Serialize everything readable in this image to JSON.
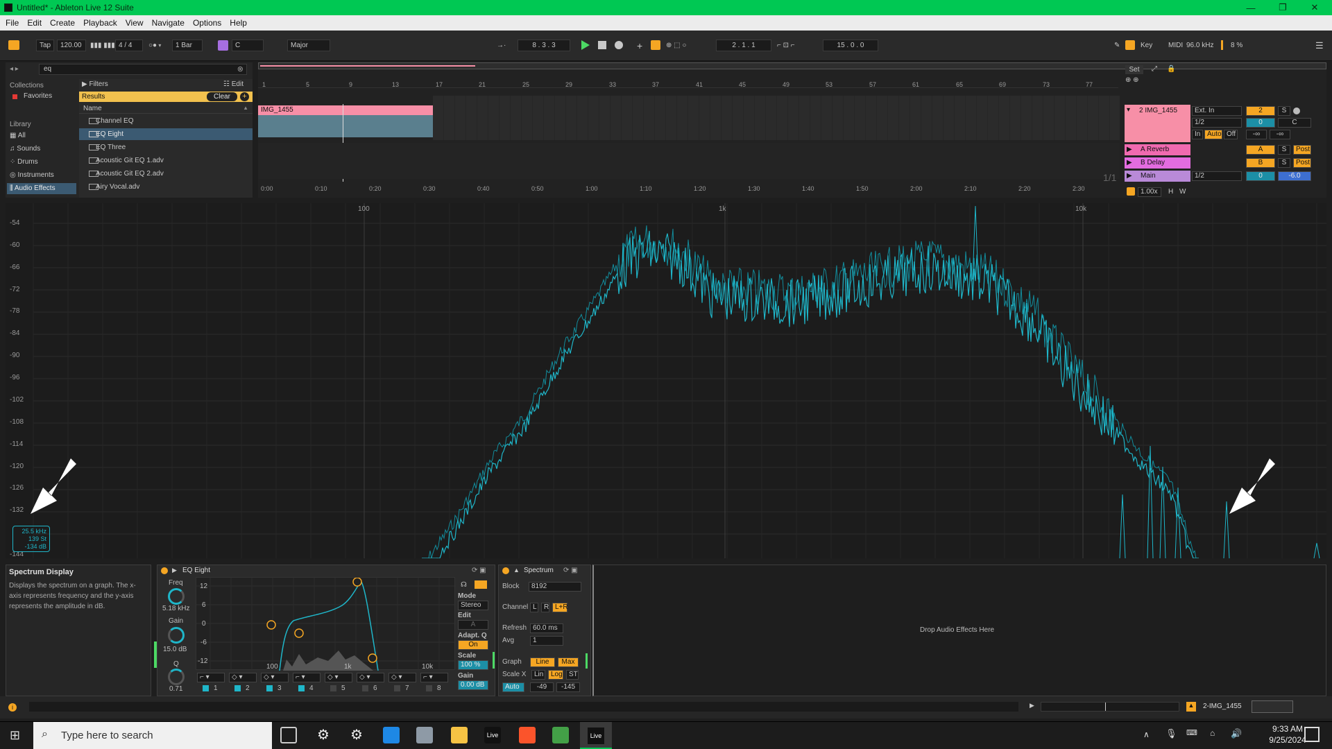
{
  "window": {
    "title": "Untitled* - Ableton Live 12 Suite"
  },
  "menu": [
    "File",
    "Edit",
    "Create",
    "Playback",
    "View",
    "Navigate",
    "Options",
    "Help"
  ],
  "toolbar": {
    "tap": "Tap",
    "tempo": "120.00",
    "signature": "4 / 4",
    "quantize": "1 Bar",
    "key": "C",
    "scale": "Major",
    "position": "8 .  3 .  3",
    "loop_start": "2 .  1 .  1",
    "loop_length": "15 .  0 .  0",
    "key_label": "Key",
    "midi_label": "MIDI",
    "sample_rate": "96.0 kHz",
    "cpu": "8 %"
  },
  "browser": {
    "search_value": "eq",
    "collections_label": "Collections",
    "favorites": "Favorites",
    "library_label": "Library",
    "library": [
      "All",
      "Sounds",
      "Drums",
      "Instruments",
      "Audio Effects"
    ],
    "filters": "Filters",
    "edit": "Edit",
    "results": "Results",
    "clear": "Clear",
    "name_header": "Name",
    "items": [
      "Channel EQ",
      "EQ Eight",
      "EQ Three",
      "Acoustic Git EQ 1.adv",
      "Acoustic Git EQ 2.adv",
      "Airy Vocal.adv"
    ]
  },
  "arrangement": {
    "ruler": [
      "1",
      "5",
      "9",
      "13",
      "17",
      "21",
      "25",
      "29",
      "33",
      "37",
      "41",
      "45",
      "49",
      "53",
      "57",
      "61",
      "65",
      "69",
      "73",
      "77"
    ],
    "time": [
      "0:00",
      "0:10",
      "0:20",
      "0:30",
      "0:40",
      "0:50",
      "1:00",
      "1:10",
      "1:20",
      "1:30",
      "1:40",
      "1:50",
      "2:00",
      "2:10",
      "2:20",
      "2:30"
    ],
    "clip_name": "IMG_1455",
    "set_label": "Set",
    "page": "1/1",
    "tracks": [
      {
        "name": "2 IMG_1455",
        "input": "Ext. In",
        "channel": "1/2",
        "num": "2",
        "vol": "0",
        "pan": "C",
        "in": "In",
        "auto": "Auto",
        "off": "Off",
        "inf1": "-∞",
        "inf2": "-∞",
        "s": "S"
      },
      {
        "name": "A Reverb",
        "letter": "A",
        "s": "S",
        "post": "Post"
      },
      {
        "name": "B Delay",
        "letter": "B",
        "s": "S",
        "post": "Post"
      },
      {
        "name": "Main",
        "channel": "1/2",
        "vol": "0",
        "db": "-6.0"
      }
    ],
    "zoom": "1.00x",
    "h": "H",
    "w": "W"
  },
  "spectrum_display": {
    "y_labels": [
      "-54",
      "-60",
      "-66",
      "-72",
      "-78",
      "-84",
      "-90",
      "-96",
      "-102",
      "-108",
      "-114",
      "-120",
      "-126",
      "-132",
      "-144"
    ],
    "x_labels": [
      "100",
      "1k",
      "10k"
    ],
    "readout": {
      "freq": "25.5 kHz",
      "note": "139 St",
      "amp": "-134 dB"
    }
  },
  "info": {
    "title": "Spectrum Display",
    "text": "Displays the spectrum on a graph. The x-axis represents frequency and the y-axis represents the amplitude in dB."
  },
  "eq_eight": {
    "title": "EQ Eight",
    "freq_label": "Freq",
    "freq": "5.18 kHz",
    "gain_label": "Gain",
    "gain": "15.0 dB",
    "q_label": "Q",
    "q": "0.71",
    "y_labels": [
      "12",
      "6",
      "0",
      "-6",
      "-12"
    ],
    "x_labels": [
      "100",
      "1k",
      "10k"
    ],
    "mode_label": "Mode",
    "mode": "Stereo",
    "edit_label": "Edit",
    "edit_value": "A",
    "adaptq_label": "Adapt. Q",
    "adaptq": "On",
    "scale_label": "Scale",
    "scale": "100 %",
    "gain2_label": "Gain",
    "gain2": "0.00 dB",
    "bands": [
      "1",
      "2",
      "3",
      "4",
      "5",
      "6",
      "7",
      "8"
    ]
  },
  "spectrum_device": {
    "title": "Spectrum",
    "block_label": "Block",
    "block": "8192",
    "channel_label": "Channel",
    "ch_l": "L",
    "ch_r": "R",
    "ch_lr": "L+R",
    "refresh_label": "Refresh",
    "refresh": "60.0 ms",
    "avg_label": "Avg",
    "avg": "1",
    "graph_label": "Graph",
    "graph_line": "Line",
    "graph_max": "Max",
    "scalex_label": "Scale X",
    "lin": "Lin",
    "log": "Log",
    "st": "ST",
    "auto": "Auto",
    "range_hi": "-49",
    "range_lo": "-145"
  },
  "drop_text": "Drop Audio Effects Here",
  "statusbar": {
    "track": "2-IMG_1455"
  },
  "taskbar": {
    "search_placeholder": "Type here to search",
    "time": "9:33 AM",
    "date": "9/25/2024"
  },
  "colors": {
    "accent_orange": "#f5a623",
    "clip_pink": "#f78fa7",
    "spectrum": "#1fb6c9",
    "green": "#00c853",
    "return_pink": "#e36ce0"
  }
}
